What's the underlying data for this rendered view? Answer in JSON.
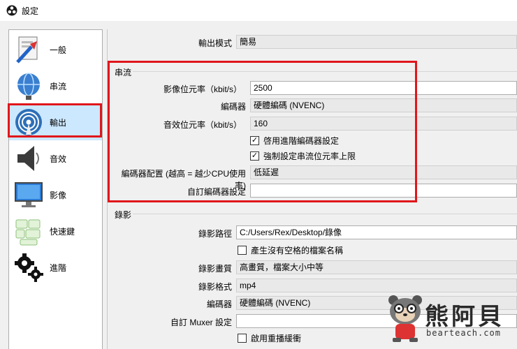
{
  "window": {
    "title": "設定",
    "app_icon": "obs-logo-icon"
  },
  "sidebar": {
    "items": [
      {
        "label": "一般",
        "icon": "general-settings-icon"
      },
      {
        "label": "串流",
        "icon": "stream-globe-icon"
      },
      {
        "label": "輸出",
        "icon": "output-broadcast-icon",
        "selected": true
      },
      {
        "label": "音效",
        "icon": "speaker-icon"
      },
      {
        "label": "影像",
        "icon": "monitor-icon"
      },
      {
        "label": "快速鍵",
        "icon": "keyboard-icon"
      },
      {
        "label": "進階",
        "icon": "gears-icon"
      }
    ]
  },
  "output": {
    "mode_label": "輸出模式",
    "mode_value": "簡易"
  },
  "streaming": {
    "section_title": "串流",
    "video_bitrate_label": "影像位元率（kbit/s）",
    "video_bitrate_value": "2500",
    "encoder_label": "編碼器",
    "encoder_value": "硬體編碼 (NVENC)",
    "audio_bitrate_label": "音效位元率（kbit/s）",
    "audio_bitrate_value": "160",
    "advanced_encoder_checkbox": "啓用進階編碼器設定",
    "advanced_encoder_checked": true,
    "enforce_limits_checkbox": "強制設定串流位元率上限",
    "enforce_limits_checked": true,
    "encoder_preset_label": "編碼器配置 (越高 = 越少CPU使用率)",
    "encoder_preset_value": "低延遲",
    "custom_encoder_label": "自訂編碼器設定",
    "custom_encoder_value": ""
  },
  "recording": {
    "section_title": "錄影",
    "path_label": "錄影路徑",
    "path_value": "C:/Users/Rex/Desktop/錄像",
    "no_space_checkbox": "產生沒有空格的檔案名稱",
    "no_space_checked": false,
    "quality_label": "錄影畫質",
    "quality_value": "高畫質，檔案大小中等",
    "format_label": "錄影格式",
    "format_value": "mp4",
    "encoder_label": "編碼器",
    "encoder_value": "硬體編碼 (NVENC)",
    "muxer_label": "自訂 Muxer 設定",
    "muxer_value": "",
    "replay_buffer_checkbox": "啟用重播緩衝",
    "replay_buffer_checked": false
  },
  "watermark": {
    "text": "熊阿貝",
    "url": "bearteach.com"
  },
  "colors": {
    "highlight": "#e0161b",
    "selected_bg": "#cce8ff"
  }
}
